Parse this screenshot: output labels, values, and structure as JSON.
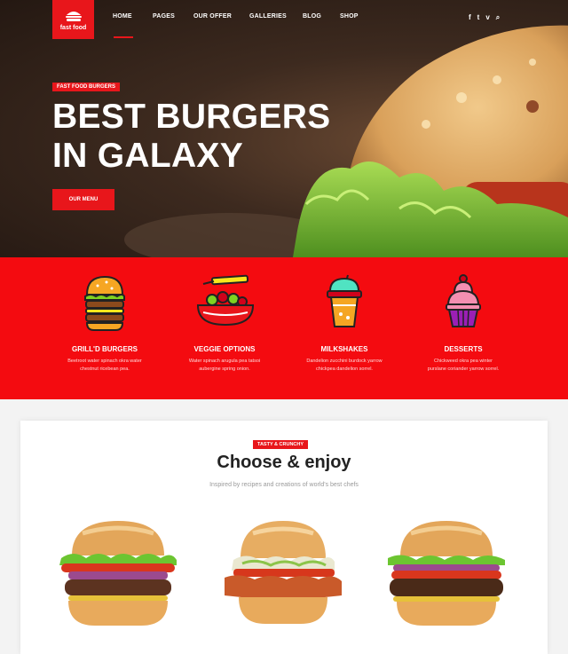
{
  "brand": {
    "logo_text": "fast food"
  },
  "nav": {
    "items": [
      "HOME",
      "PAGES",
      "OUR OFFER",
      "GALLERIES",
      "BLOG",
      "SHOP"
    ]
  },
  "social": {
    "icons": [
      "facebook-icon",
      "twitter-icon",
      "vine-icon",
      "search-icon"
    ],
    "glyphs": [
      "f",
      "t",
      "v",
      "⌕"
    ]
  },
  "hero": {
    "badge": "FAST FOOD BURGERS",
    "title_line1": "BEST BURGERS",
    "title_line2": "IN GALAXY",
    "button": "OUR MENU"
  },
  "features": [
    {
      "icon": "burger-icon",
      "title": "GRILL'D BURGERS",
      "desc_line1": "Beetroot water spinach okra water",
      "desc_line2": "chestnut ricebean pea."
    },
    {
      "icon": "salad-bowl-icon",
      "title": "VEGGIE OPTIONS",
      "desc_line1": "Water spinach arugula pea tatsoi",
      "desc_line2": "aubergine spring onion."
    },
    {
      "icon": "milkshake-icon",
      "title": "MILKSHAKES",
      "desc_line1": "Dandelion zucchini burdock yarrow",
      "desc_line2": "chickpea dandelion sorrel."
    },
    {
      "icon": "cupcake-icon",
      "title": "DESSERTS",
      "desc_line1": "Chickweed okra pea winter",
      "desc_line2": "purslane coriander yarrow sorrel."
    }
  ],
  "choose": {
    "badge": "TASTY & CRUNCHY",
    "title": "Choose & enjoy",
    "subtitle": "Inspired by recipes and creations of world's best chefs"
  },
  "colors": {
    "accent": "#e8161b",
    "features_bg": "#f40b10"
  }
}
